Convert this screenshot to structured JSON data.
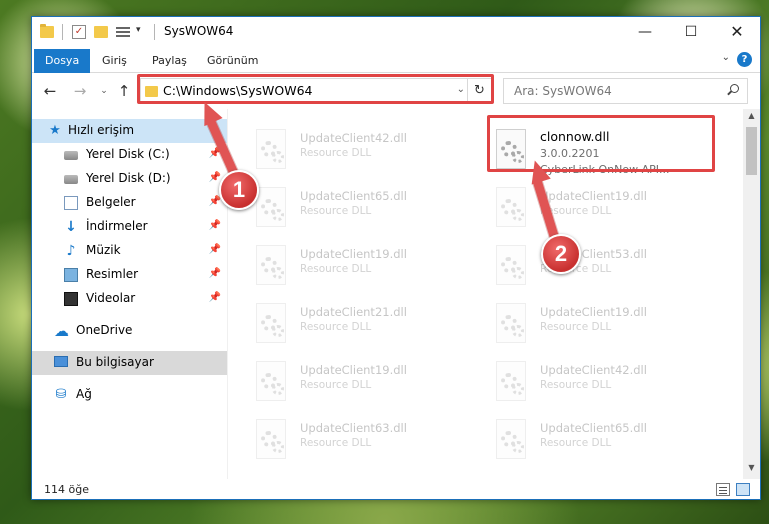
{
  "window": {
    "title": "SysWOW64",
    "minimize_glyph": "—",
    "maximize_glyph": "☐",
    "close_glyph": "✕"
  },
  "ribbon": {
    "tabs": [
      {
        "label": "Dosya"
      },
      {
        "label": "Giriş"
      },
      {
        "label": "Paylaş"
      },
      {
        "label": "Görünüm"
      }
    ],
    "expand_glyph": "⌄",
    "help_glyph": "?"
  },
  "address_bar": {
    "path": "C:\\Windows\\SysWOW64",
    "dropdown_glyph": "⌄",
    "refresh_glyph": "↻"
  },
  "search": {
    "placeholder": "Ara: SysWOW64"
  },
  "nav": {
    "back_glyph": "←",
    "forward_glyph": "→",
    "recent_glyph": "⌄",
    "up_glyph": "↑"
  },
  "navpane": {
    "quick_access": "Hızlı erişim",
    "items": [
      {
        "label": "Yerel Disk (C:)",
        "icon": "disk-icon"
      },
      {
        "label": "Yerel Disk (D:)",
        "icon": "disk-icon"
      },
      {
        "label": "Belgeler",
        "icon": "documents-icon"
      },
      {
        "label": "İndirmeler",
        "icon": "downloads-icon"
      },
      {
        "label": "Müzik",
        "icon": "music-icon"
      },
      {
        "label": "Resimler",
        "icon": "pictures-icon"
      },
      {
        "label": "Videolar",
        "icon": "videos-icon"
      }
    ],
    "onedrive": "OneDrive",
    "this_pc": "Bu bilgisayar",
    "network": "Ağ",
    "pin_glyph": "📌"
  },
  "files": [
    {
      "name": "UpdateClient42.dll",
      "desc": "Resource DLL"
    },
    {
      "name": "clonnow.dll",
      "version": "3.0.0.2201",
      "desc": "CyberLink OnNow API..."
    },
    {
      "name": "UpdateClient65.dll",
      "desc": "Resource DLL"
    },
    {
      "name": "UpdateClient19.dll",
      "desc": "Resource DLL"
    },
    {
      "name": "UpdateClient19.dll",
      "desc": "Resource DLL"
    },
    {
      "name": "UpdateClient53.dll",
      "desc": "Resource DLL"
    },
    {
      "name": "UpdateClient21.dll",
      "desc": "Resource DLL"
    },
    {
      "name": "UpdateClient19.dll",
      "desc": "Resource DLL"
    },
    {
      "name": "UpdateClient19.dll",
      "desc": "Resource DLL"
    },
    {
      "name": "UpdateClient42.dll",
      "desc": "Resource DLL"
    },
    {
      "name": "UpdateClient63.dll",
      "desc": "Resource DLL"
    },
    {
      "name": "UpdateClient65.dll",
      "desc": "Resource DLL"
    }
  ],
  "status": {
    "item_count": "114 öğe"
  },
  "annotations": {
    "step1": "1",
    "step2": "2",
    "highlight_color": "#e04444"
  },
  "scroll": {
    "up_glyph": "▲",
    "down_glyph": "▼"
  }
}
